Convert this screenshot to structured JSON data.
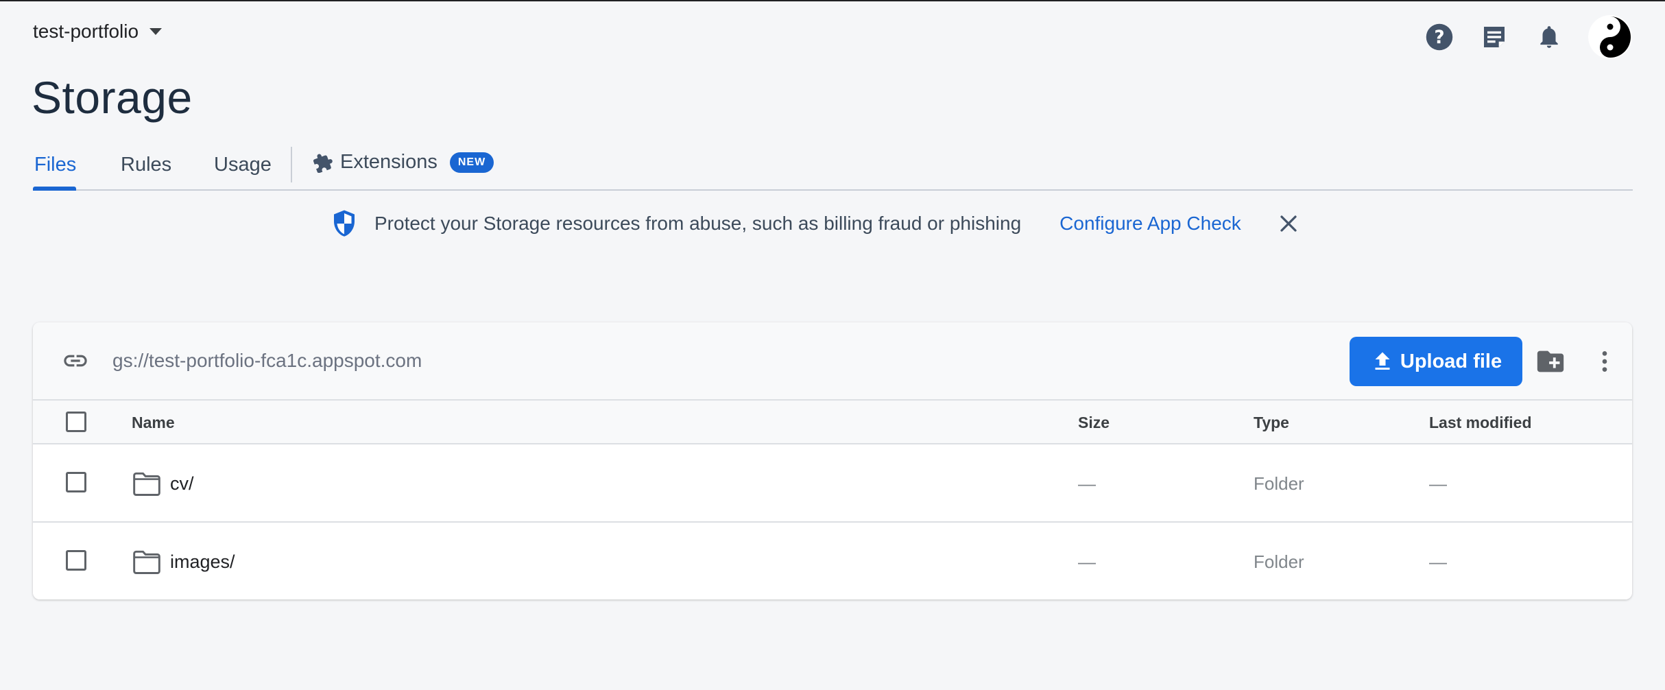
{
  "header": {
    "project_name": "test-portfolio",
    "page_title": "Storage"
  },
  "tabs": [
    {
      "label": "Files",
      "active": true
    },
    {
      "label": "Rules",
      "active": false
    },
    {
      "label": "Usage",
      "active": false
    },
    {
      "label": "Extensions",
      "active": false,
      "badge": "NEW"
    }
  ],
  "banner": {
    "message": "Protect your Storage resources from abuse, such as billing fraud or phishing",
    "action": "Configure App Check"
  },
  "bucket": {
    "path": "gs://test-portfolio-fca1c.appspot.com",
    "upload_label": "Upload file"
  },
  "table": {
    "columns": [
      "Name",
      "Size",
      "Type",
      "Last modified"
    ],
    "rows": [
      {
        "name": "cv/",
        "size": "—",
        "type": "Folder",
        "modified": "—"
      },
      {
        "name": "images/",
        "size": "—",
        "type": "Folder",
        "modified": "—"
      }
    ]
  },
  "colors": {
    "accent": "#1a66d2",
    "upload_button": "#1a73e8",
    "background": "#f5f6f8"
  },
  "icons": [
    "help-icon",
    "release-notes-icon",
    "notifications-icon",
    "avatar",
    "puzzle-icon",
    "shield-icon",
    "close-icon",
    "link-icon",
    "upload-icon",
    "new-folder-icon",
    "more-vert-icon",
    "folder-icon"
  ]
}
